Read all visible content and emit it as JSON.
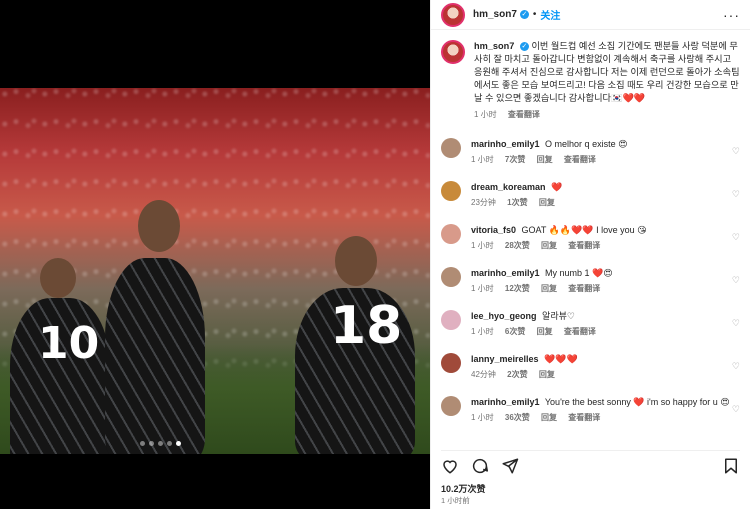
{
  "post": {
    "username": "hm_son7",
    "follow_label": "关注",
    "more_label": "···",
    "caption": "이번 월드컵 예선 소집 기간에도 팬분들 사랑 덕분에 무사히 잘 마치고 돌아갑니다 변함없이 계속해서 축구를 사랑해 주시고 응원해 주셔서 진심으로 감사합니다 저는 이제 런던으로 돌아가 소속팀에서도 좋은 모습 보여드리고! 다음 소집 때도 우리 건강한 모습으로 만날 수 있으면 좋겠습니다 감사합니다",
    "caption_suffix": "🇰🇷❤️❤️",
    "caption_time": "1 小时",
    "translate_label": "查看翻译",
    "jersey_left": "10",
    "jersey_right": "18"
  },
  "comments": [
    {
      "user": "marinho_emily1",
      "text": "O melhor q existe 😍",
      "time": "1 小时",
      "likes": "7次赞",
      "reply": "回复",
      "translate": "查看翻译",
      "avatar_color": "#b08c74"
    },
    {
      "user": "dream_koreaman",
      "text": "❤️",
      "time": "23分钟",
      "likes": "1次赞",
      "reply": "回复",
      "translate": "",
      "avatar_color": "#c88a3a"
    },
    {
      "user": "vitoria_fs0",
      "text": "GOAT 🔥🔥❤️❤️ I love you 😘",
      "time": "1 小时",
      "likes": "28次赞",
      "reply": "回复",
      "translate": "查看翻译",
      "avatar_color": "#d89a8a"
    },
    {
      "user": "marinho_emily1",
      "text": "My numb 1 ❤️😍",
      "time": "1 小时",
      "likes": "12次赞",
      "reply": "回复",
      "translate": "查看翻译",
      "avatar_color": "#b08c74"
    },
    {
      "user": "lee_hyo_geong",
      "text": "알라뷰♡",
      "time": "1 小时",
      "likes": "6次赞",
      "reply": "回复",
      "translate": "查看翻译",
      "avatar_color": "#e0b0c0"
    },
    {
      "user": "lanny_meirelles",
      "text": "❤️❤️❤️",
      "time": "42分钟",
      "likes": "2次赞",
      "reply": "回复",
      "translate": "",
      "avatar_color": "#a04a3a"
    },
    {
      "user": "marinho_emily1",
      "text": "You're the best sonny ❤️ i'm so happy for u 😍",
      "time": "1 小时",
      "likes": "36次赞",
      "reply": "回复",
      "translate": "查看翻译",
      "avatar_color": "#b08c74"
    }
  ],
  "footer": {
    "likes": "10.2万次赞",
    "time": "1 小时前"
  },
  "icons": [
    "heart-icon",
    "comment-icon",
    "share-icon",
    "save-icon",
    "verified-icon",
    "more-icon"
  ],
  "colors": {
    "link": "#0095f6",
    "verified": "#1d9bf0",
    "heart": "#e8203a"
  }
}
